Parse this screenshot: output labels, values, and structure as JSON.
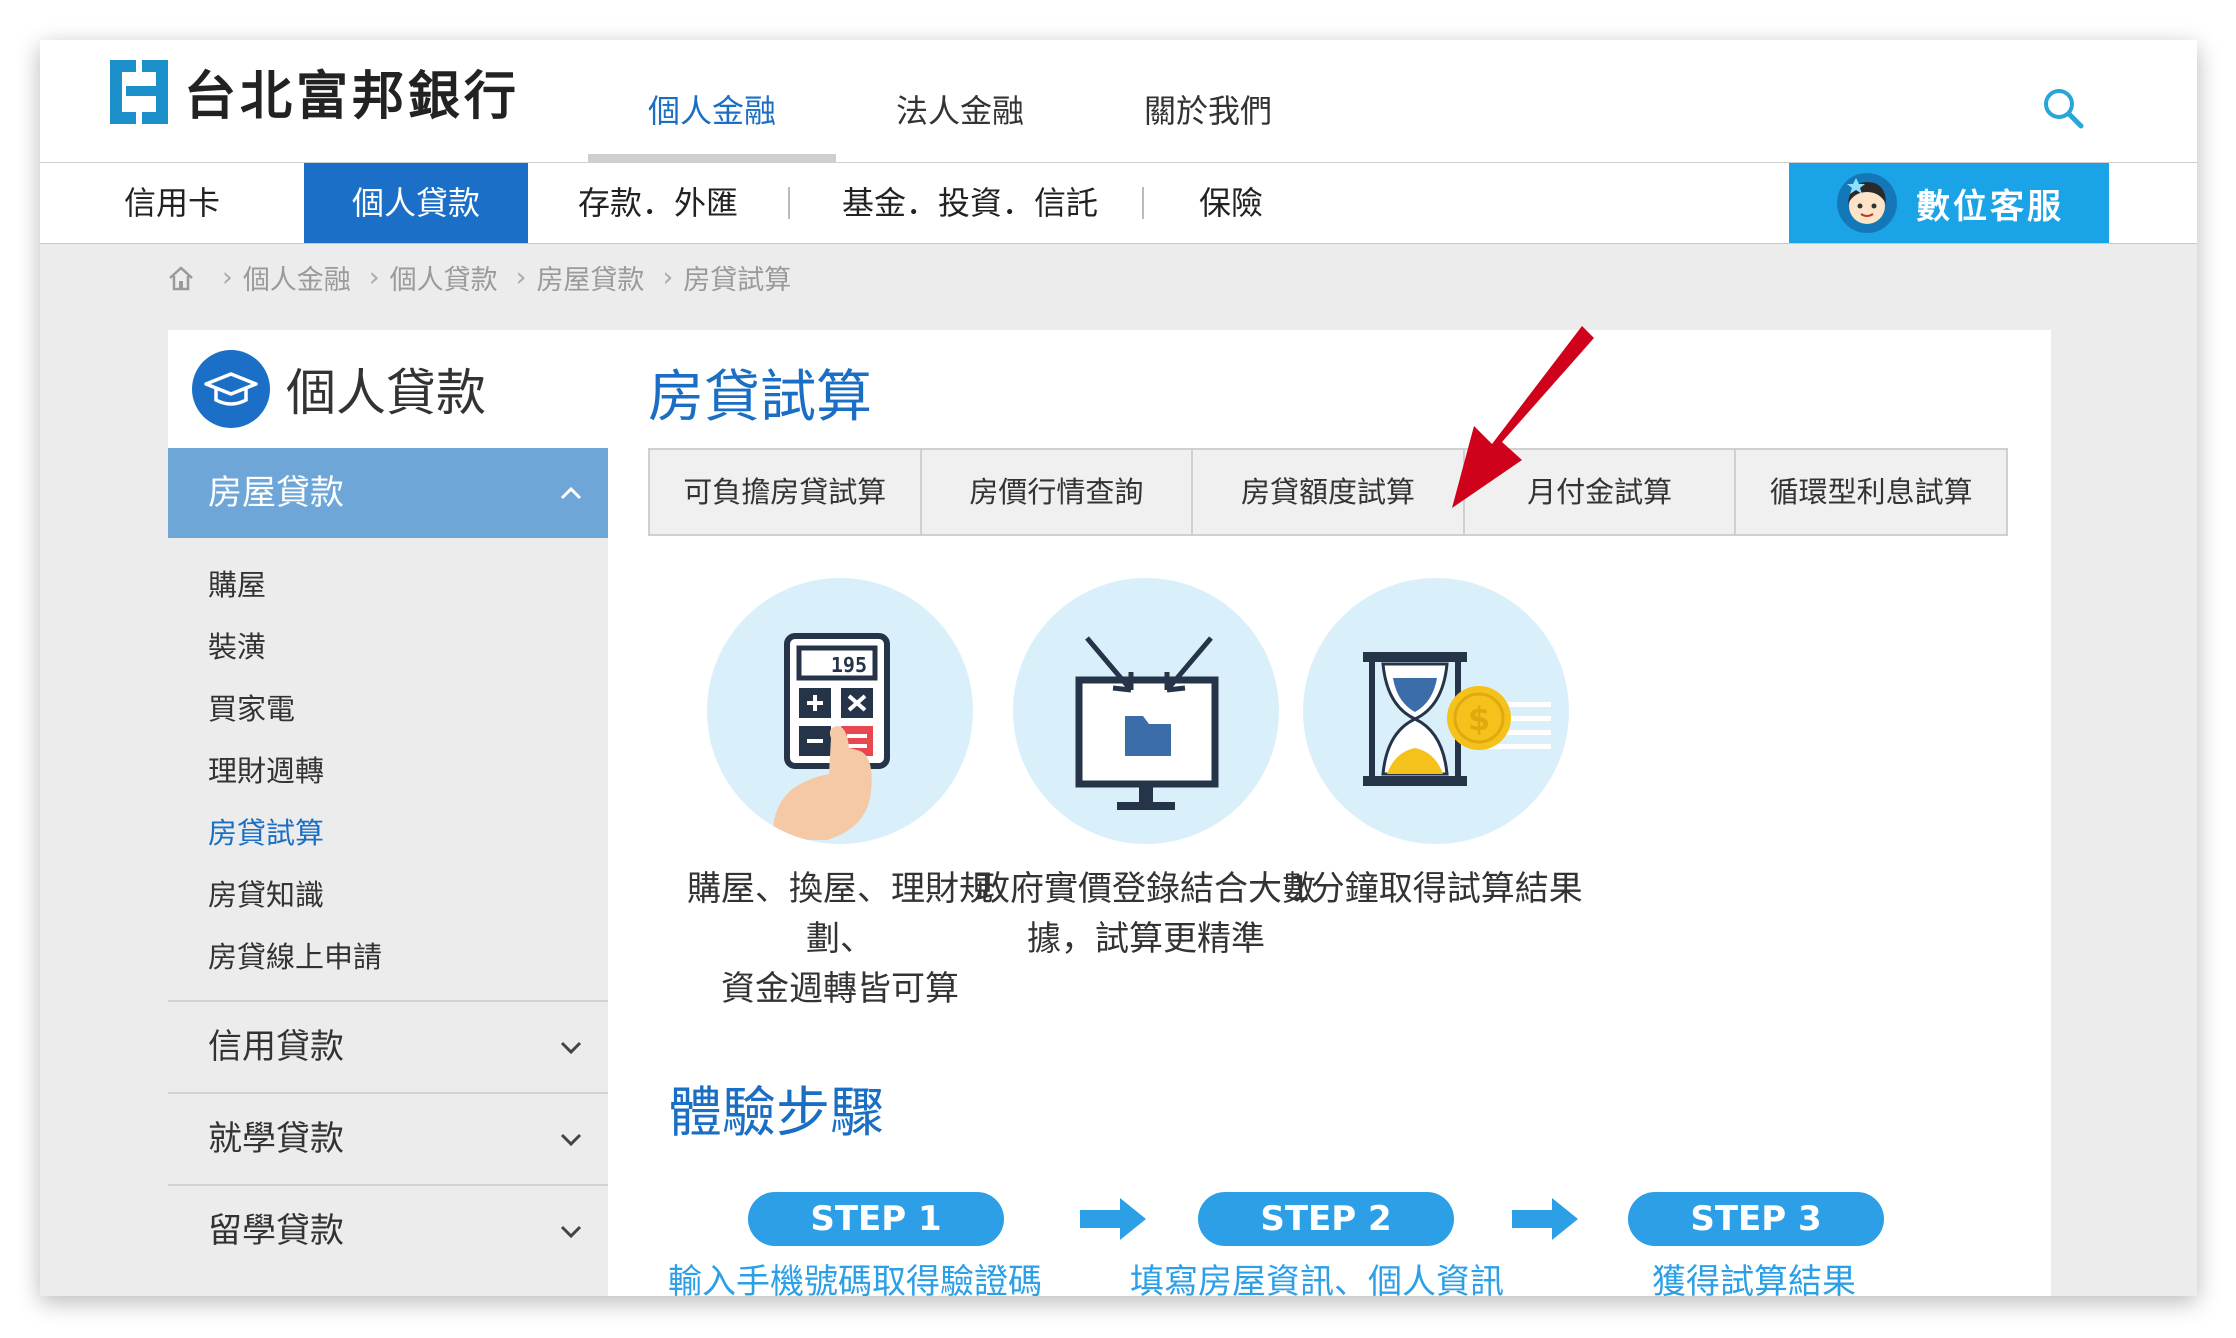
{
  "brand": {
    "name": "台北富邦銀行"
  },
  "top_nav": [
    "個人金融",
    "法人金融",
    "關於我們"
  ],
  "sub_nav": [
    "信用卡",
    "個人貸款",
    "存款．外匯",
    "基金．投資．信託",
    "保險"
  ],
  "service_button": "數位客服",
  "breadcrumb": [
    "個人金融",
    "個人貸款",
    "房屋貸款",
    "房貸試算"
  ],
  "sidebar": {
    "title": "個人貸款",
    "active_category": "房屋貸款",
    "sub_items": [
      "購屋",
      "裝潢",
      "買家電",
      "理財週轉",
      "房貸試算",
      "房貸知識",
      "房貸線上申請"
    ],
    "categories": [
      "信用貸款",
      "就學貸款",
      "留學貸款"
    ]
  },
  "content": {
    "title": "房貸試算",
    "tabs": [
      "可負擔房貸試算",
      "房價行情查詢",
      "房貸額度試算",
      "月付金試算",
      "循環型利息試算"
    ],
    "features": [
      {
        "line1": "購屋、換屋、理財規劃、",
        "line2": "資金週轉皆可算",
        "calc_display": "195"
      },
      {
        "line1": "政府實價登錄結合大數",
        "line2": "據，試算更精準"
      },
      {
        "line1": "1分鐘取得試算結果",
        "line2": ""
      }
    ],
    "steps_title": "體驗步驟",
    "steps": [
      {
        "label": "STEP 1",
        "desc": "輸入手機號碼取得驗證碼"
      },
      {
        "label": "STEP 2",
        "desc": "填寫房屋資訊、個人資訊"
      },
      {
        "label": "STEP 3",
        "desc": "獲得試算結果"
      }
    ]
  },
  "colors": {
    "primary_blue": "#1b6fc6",
    "accent_blue": "#2d9fe6",
    "arrow_red": "#d0021b",
    "sidebar_active": "#6ea6d7"
  }
}
